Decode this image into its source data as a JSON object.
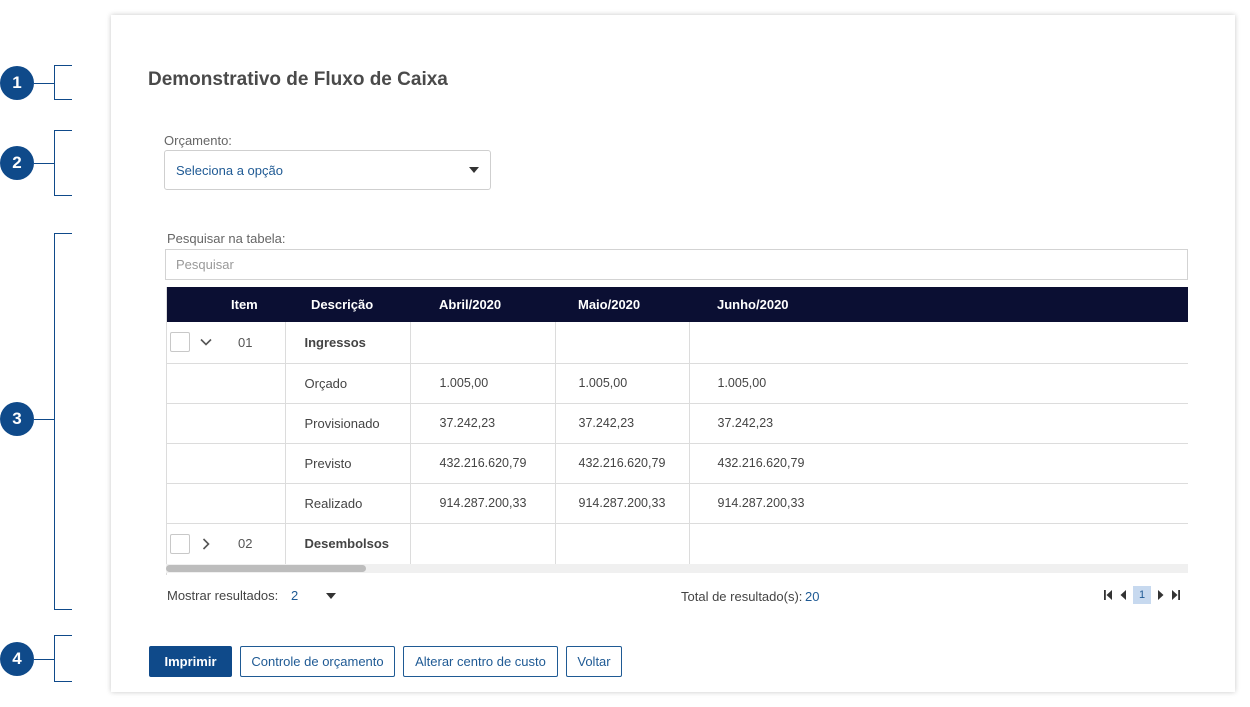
{
  "markers": [
    "1",
    "2",
    "3",
    "4"
  ],
  "page": {
    "title": "Demonstrativo de Fluxo de Caixa"
  },
  "budget": {
    "label": "Orçamento:",
    "value": "Seleciona a opção"
  },
  "search": {
    "label": "Pesquisar na tabela:",
    "placeholder": "Pesquisar"
  },
  "table": {
    "headers": [
      "Item",
      "Descrição",
      "Abril/2020",
      "Maio/2020",
      "Junho/2020"
    ],
    "groups": [
      {
        "item": "01",
        "label": "Ingressos",
        "expanded": true,
        "rows": [
          {
            "label": "Orçado",
            "values": [
              "1.005,00",
              "1.005,00",
              "1.005,00"
            ]
          },
          {
            "label": "Provisionado",
            "values": [
              "37.242,23",
              "37.242,23",
              "37.242,23"
            ]
          },
          {
            "label": "Previsto",
            "values": [
              "432.216.620,79",
              "432.216.620,79",
              "432.216.620,79"
            ]
          },
          {
            "label": "Realizado",
            "values": [
              "914.287.200,33",
              "914.287.200,33",
              "914.287.200,33"
            ]
          }
        ]
      },
      {
        "item": "02",
        "label": "Desembolsos",
        "expanded": false
      }
    ]
  },
  "footer": {
    "show_results_label": "Mostrar resultados:",
    "show_results_value": "2",
    "total_label": "Total de resultado(s):",
    "total_value": "20",
    "current_page": "1"
  },
  "buttons": {
    "print": "Imprimir",
    "budget_control": "Controle de orçamento",
    "change_cost_center": "Alterar centro de custo",
    "back": "Voltar"
  },
  "colors": {
    "accent": "#0f4a8a",
    "table_header": "#0b0f33",
    "link": "#1f5a94"
  }
}
